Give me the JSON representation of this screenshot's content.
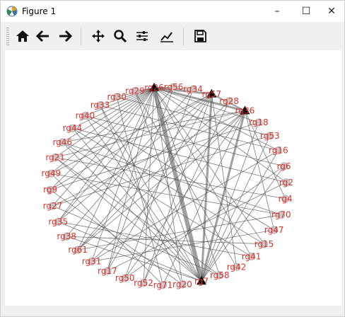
{
  "window": {
    "title": "Figure 1",
    "minimize_label": "–",
    "maximize_label": "☐",
    "close_label": "✕"
  },
  "toolbar": {
    "buttons": [
      {
        "name": "home-button",
        "icon": "home-icon"
      },
      {
        "name": "back-button",
        "icon": "arrow-left-icon"
      },
      {
        "name": "forward-button",
        "icon": "arrow-right-icon"
      },
      {
        "name": "pan-button",
        "icon": "move-icon"
      },
      {
        "name": "zoom-button",
        "icon": "zoom-icon"
      },
      {
        "name": "subplots-button",
        "icon": "sliders-icon"
      },
      {
        "name": "edit-axes-button",
        "icon": "chart-edit-icon"
      },
      {
        "name": "save-button",
        "icon": "save-icon"
      }
    ]
  },
  "graph": {
    "node_color": "#c8c8c8",
    "label_color": "#e0302a",
    "edge_color": "#505050",
    "nodes": [
      "rg26",
      "rg56",
      "rg34",
      "rg57",
      "rg28",
      "rg36",
      "rg18",
      "rg53",
      "rg16",
      "rg6",
      "rg2",
      "rg4",
      "rg70",
      "rg47",
      "rg15",
      "rg41",
      "rg42",
      "rg58",
      "rg7",
      "rg20",
      "rg71",
      "rg52",
      "rg50",
      "rg17",
      "rg31",
      "rg61",
      "rg38",
      "rg35",
      "rg27",
      "rg9",
      "rg49",
      "rg21",
      "rg46",
      "rg44",
      "rg40",
      "rg33",
      "rg30",
      "rg29"
    ],
    "hub_nodes": [
      "rg26",
      "rg57",
      "rg36",
      "rg7"
    ],
    "edges": [
      [
        "rg26",
        "rg7",
        6
      ],
      [
        "rg57",
        "rg7",
        3
      ],
      [
        "rg36",
        "rg7",
        3
      ],
      [
        "rg26",
        "rg57",
        3
      ],
      [
        "rg26",
        "rg36",
        3
      ],
      [
        "rg57",
        "rg36",
        2
      ],
      [
        "rg26",
        "rg29",
        1
      ],
      [
        "rg26",
        "rg30",
        1
      ],
      [
        "rg26",
        "rg33",
        1
      ],
      [
        "rg26",
        "rg40",
        1
      ],
      [
        "rg26",
        "rg44",
        1
      ],
      [
        "rg26",
        "rg46",
        1
      ],
      [
        "rg26",
        "rg21",
        1
      ],
      [
        "rg26",
        "rg49",
        1
      ],
      [
        "rg26",
        "rg9",
        1
      ],
      [
        "rg26",
        "rg27",
        1
      ],
      [
        "rg26",
        "rg35",
        1
      ],
      [
        "rg26",
        "rg61",
        1
      ],
      [
        "rg26",
        "rg31",
        1
      ],
      [
        "rg26",
        "rg17",
        1
      ],
      [
        "rg26",
        "rg52",
        1
      ],
      [
        "rg26",
        "rg20",
        1
      ],
      [
        "rg26",
        "rg58",
        1
      ],
      [
        "rg26",
        "rg41",
        1
      ],
      [
        "rg26",
        "rg15",
        1
      ],
      [
        "rg26",
        "rg2",
        1
      ],
      [
        "rg26",
        "rg16",
        1
      ],
      [
        "rg26",
        "rg18",
        1
      ],
      [
        "rg26",
        "rg34",
        1
      ],
      [
        "rg26",
        "rg56",
        1
      ],
      [
        "rg7",
        "rg44",
        1
      ],
      [
        "rg7",
        "rg40",
        1
      ],
      [
        "rg7",
        "rg33",
        1
      ],
      [
        "rg7",
        "rg46",
        1
      ],
      [
        "rg7",
        "rg21",
        1
      ],
      [
        "rg7",
        "rg29",
        1
      ],
      [
        "rg7",
        "rg18",
        1
      ],
      [
        "rg7",
        "rg16",
        1
      ],
      [
        "rg7",
        "rg53",
        1
      ],
      [
        "rg7",
        "rg6",
        1
      ],
      [
        "rg7",
        "rg38",
        1
      ],
      [
        "rg7",
        "rg35",
        1
      ],
      [
        "rg36",
        "rg46",
        1
      ],
      [
        "rg36",
        "rg21",
        1
      ],
      [
        "rg36",
        "rg27",
        1
      ],
      [
        "rg36",
        "rg31",
        1
      ],
      [
        "rg36",
        "rg61",
        1
      ],
      [
        "rg36",
        "rg50",
        1
      ],
      [
        "rg36",
        "rg71",
        1
      ],
      [
        "rg36",
        "rg47",
        1
      ],
      [
        "rg36",
        "rg4",
        1
      ],
      [
        "rg57",
        "rg49",
        1
      ],
      [
        "rg57",
        "rg35",
        1
      ],
      [
        "rg57",
        "rg17",
        1
      ],
      [
        "rg57",
        "rg52",
        1
      ],
      [
        "rg57",
        "rg61",
        1
      ],
      [
        "rg57",
        "rg9",
        1
      ],
      [
        "rg57",
        "rg42",
        1
      ],
      [
        "rg40",
        "rg6",
        1
      ],
      [
        "rg44",
        "rg2",
        1
      ],
      [
        "rg46",
        "rg70",
        1
      ],
      [
        "rg21",
        "rg4",
        1
      ],
      [
        "rg33",
        "rg16",
        1
      ],
      [
        "rg30",
        "rg53",
        1
      ],
      [
        "rg29",
        "rg42",
        1
      ],
      [
        "rg56",
        "rg35",
        1
      ],
      [
        "rg34",
        "rg38",
        1
      ],
      [
        "rg28",
        "rg61",
        1
      ],
      [
        "rg18",
        "rg9",
        1
      ],
      [
        "rg53",
        "rg27",
        1
      ],
      [
        "rg16",
        "rg31",
        1
      ],
      [
        "rg6",
        "rg50",
        1
      ],
      [
        "rg2",
        "rg17",
        1
      ],
      [
        "rg70",
        "rg49",
        1
      ],
      [
        "rg47",
        "rg40",
        1
      ],
      [
        "rg15",
        "rg44",
        1
      ],
      [
        "rg41",
        "rg46",
        1
      ],
      [
        "rg58",
        "rg21",
        1
      ],
      [
        "rg20",
        "rg33",
        1
      ],
      [
        "rg71",
        "rg30",
        1
      ],
      [
        "rg52",
        "rg28",
        1
      ],
      [
        "rg50",
        "rg34",
        1
      ],
      [
        "rg17",
        "rg56",
        1
      ],
      [
        "rg31",
        "rg47",
        1
      ],
      [
        "rg61",
        "rg70",
        1
      ],
      [
        "rg38",
        "rg15",
        1
      ],
      [
        "rg35",
        "rg41",
        1
      ],
      [
        "rg27",
        "rg58",
        1
      ],
      [
        "rg9",
        "rg20",
        1
      ],
      [
        "rg49",
        "rg71",
        1
      ]
    ]
  }
}
